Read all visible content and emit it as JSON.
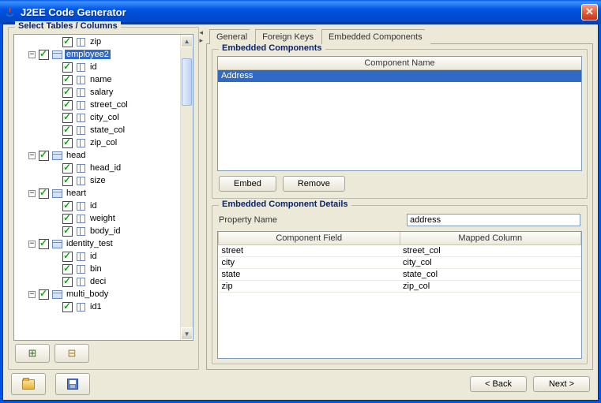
{
  "window": {
    "title": "J2EE Code Generator"
  },
  "left": {
    "title": "Select Tables / Columns",
    "selected_node": "employee2",
    "nodes": [
      {
        "level": 2,
        "toggle": "",
        "check": true,
        "icon": "col",
        "label": "zip"
      },
      {
        "level": 1,
        "toggle": "-",
        "check": true,
        "icon": "table",
        "label": "employee2",
        "selected": true
      },
      {
        "level": 2,
        "toggle": "",
        "check": true,
        "icon": "col",
        "label": "id"
      },
      {
        "level": 2,
        "toggle": "",
        "check": true,
        "icon": "col",
        "label": "name"
      },
      {
        "level": 2,
        "toggle": "",
        "check": true,
        "icon": "col",
        "label": "salary"
      },
      {
        "level": 2,
        "toggle": "",
        "check": true,
        "icon": "col",
        "label": "street_col"
      },
      {
        "level": 2,
        "toggle": "",
        "check": true,
        "icon": "col",
        "label": "city_col"
      },
      {
        "level": 2,
        "toggle": "",
        "check": true,
        "icon": "col",
        "label": "state_col"
      },
      {
        "level": 2,
        "toggle": "",
        "check": true,
        "icon": "col",
        "label": "zip_col"
      },
      {
        "level": 1,
        "toggle": "-",
        "check": true,
        "icon": "table",
        "label": "head"
      },
      {
        "level": 2,
        "toggle": "",
        "check": true,
        "icon": "col",
        "label": "head_id"
      },
      {
        "level": 2,
        "toggle": "",
        "check": true,
        "icon": "col",
        "label": "size"
      },
      {
        "level": 1,
        "toggle": "-",
        "check": true,
        "icon": "table",
        "label": "heart"
      },
      {
        "level": 2,
        "toggle": "",
        "check": true,
        "icon": "col",
        "label": "id"
      },
      {
        "level": 2,
        "toggle": "",
        "check": true,
        "icon": "col",
        "label": "weight"
      },
      {
        "level": 2,
        "toggle": "",
        "check": true,
        "icon": "col",
        "label": "body_id"
      },
      {
        "level": 1,
        "toggle": "-",
        "check": true,
        "icon": "table",
        "label": "identity_test"
      },
      {
        "level": 2,
        "toggle": "",
        "check": true,
        "icon": "col",
        "label": "id"
      },
      {
        "level": 2,
        "toggle": "",
        "check": true,
        "icon": "col",
        "label": "bin"
      },
      {
        "level": 2,
        "toggle": "",
        "check": true,
        "icon": "col",
        "label": "deci"
      },
      {
        "level": 1,
        "toggle": "-",
        "check": true,
        "icon": "table",
        "label": "multi_body"
      },
      {
        "level": 2,
        "toggle": "",
        "check": true,
        "icon": "col",
        "label": "id1"
      }
    ]
  },
  "tabs": {
    "items": [
      "General",
      "Foreign Keys",
      "Embedded Components"
    ],
    "active": 2
  },
  "embedded": {
    "group_title": "Embedded Components",
    "header": "Component Name",
    "rows": [
      "Address"
    ],
    "selected_row": 0,
    "embed_btn": "Embed",
    "remove_btn": "Remove"
  },
  "details": {
    "group_title": "Embedded Component Details",
    "property_label": "Property Name",
    "property_value": "address",
    "col_field": "Component Field",
    "col_mapped": "Mapped Column",
    "rows": [
      {
        "field": "street",
        "mapped": "street_col"
      },
      {
        "field": "city",
        "mapped": "city_col"
      },
      {
        "field": "state",
        "mapped": "state_col"
      },
      {
        "field": "zip",
        "mapped": "zip_col"
      }
    ]
  },
  "footer": {
    "back": "< Back",
    "next": "Next >"
  }
}
